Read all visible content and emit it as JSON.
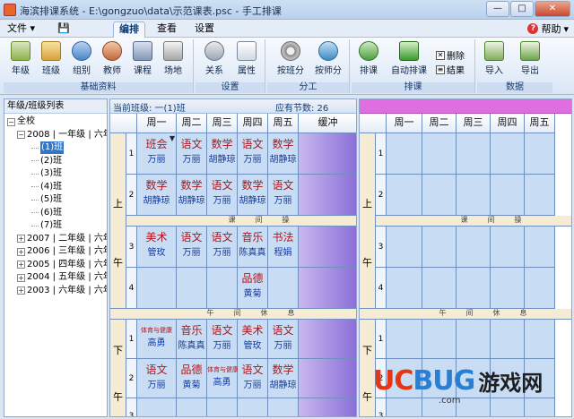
{
  "window": {
    "title": "海滨排课系统 - E:\\gongzuo\\data\\示范课表.psc - 手工排课",
    "minimize": "—",
    "maximize": "□",
    "close": "✕"
  },
  "menubar": {
    "file": "文件",
    "tabs": [
      "编排",
      "查看",
      "设置"
    ],
    "active_tab": "编排",
    "help": "帮助"
  },
  "ribbon": {
    "groups": [
      {
        "label": "基础资料",
        "buttons": [
          "年级",
          "班级",
          "组别",
          "教师",
          "课程",
          "场地"
        ]
      },
      {
        "label": "设置",
        "buttons": [
          "关系",
          "属性"
        ]
      },
      {
        "label": "分工",
        "buttons": [
          "按班分",
          "按师分"
        ]
      },
      {
        "label": "排课",
        "buttons": [
          "排课",
          "自动排课"
        ],
        "small": [
          "删除",
          "结果"
        ]
      },
      {
        "label": "数据",
        "buttons": [
          "导入",
          "导出"
        ]
      }
    ]
  },
  "left_panel": {
    "header": "年级/班级列表",
    "tree": [
      {
        "label": "全校",
        "level": 0,
        "toggle": "−"
      },
      {
        "label": "2008 | 一年级 | 六年",
        "level": 1,
        "toggle": "−"
      },
      {
        "label": "(1)班",
        "level": 2,
        "selected": true
      },
      {
        "label": "(2)班",
        "level": 2
      },
      {
        "label": "(3)班",
        "level": 2
      },
      {
        "label": "(4)班",
        "level": 2
      },
      {
        "label": "(5)班",
        "level": 2
      },
      {
        "label": "(6)班",
        "level": 2
      },
      {
        "label": "(7)班",
        "level": 2
      },
      {
        "label": "2007 | 二年级 | 六年",
        "level": 1,
        "toggle": "+"
      },
      {
        "label": "2006 | 三年级 | 六年",
        "level": 1,
        "toggle": "+"
      },
      {
        "label": "2005 | 四年级 | 六年",
        "level": 1,
        "toggle": "+"
      },
      {
        "label": "2004 | 五年级 | 六年",
        "level": 1,
        "toggle": "+"
      },
      {
        "label": "2003 | 六年级 | 六年",
        "level": 1,
        "toggle": "+"
      }
    ]
  },
  "schedule": {
    "current_class_label": "当前班级: 一(1)班",
    "required_periods_label": "应有节数: 26",
    "days": [
      "周一",
      "周二",
      "周三",
      "周四",
      "周五"
    ],
    "buffer_label": "缓冲",
    "sessions": {
      "morning": [
        "上",
        "午"
      ],
      "afternoon": [
        "下",
        "午"
      ]
    },
    "break_label": "课间操",
    "noon_label": "午间休息",
    "periods_morning": [
      "1",
      "2",
      "3",
      "4"
    ],
    "periods_afternoon": [
      "1",
      "2",
      "3"
    ],
    "slots": {
      "m1": [
        {
          "course": "班会",
          "teacher": "万丽"
        },
        {
          "course": "语文",
          "teacher": "万丽"
        },
        {
          "course": "数学",
          "teacher": "胡静琼"
        },
        {
          "course": "语文",
          "teacher": "万丽"
        },
        {
          "course": "数学",
          "teacher": "胡静琼"
        }
      ],
      "m2": [
        {
          "course": "数学",
          "teacher": "胡静琼"
        },
        {
          "course": "数学",
          "teacher": "胡静琼"
        },
        {
          "course": "语文",
          "teacher": "万丽"
        },
        {
          "course": "数学",
          "teacher": "胡静琼"
        },
        {
          "course": "语文",
          "teacher": "万丽"
        }
      ],
      "m3": [
        {
          "course": "美术",
          "teacher": "管玫"
        },
        {
          "course": "语文",
          "teacher": "万丽"
        },
        {
          "course": "语文",
          "teacher": "万丽"
        },
        {
          "course": "音乐",
          "teacher": "陈真真"
        },
        {
          "course": "书法",
          "teacher": "程娟"
        }
      ],
      "m4": [
        {
          "course": "",
          "teacher": ""
        },
        {
          "course": "",
          "teacher": ""
        },
        {
          "course": "",
          "teacher": ""
        },
        {
          "course": "品德",
          "teacher": "黄菊"
        },
        {
          "course": "",
          "teacher": ""
        }
      ],
      "a1": [
        {
          "course": "体育与健康",
          "teacher": "高勇",
          "small": true
        },
        {
          "course": "音乐",
          "teacher": "陈真真"
        },
        {
          "course": "语文",
          "teacher": "万丽"
        },
        {
          "course": "美术",
          "teacher": "管玫"
        },
        {
          "course": "语文",
          "teacher": "万丽"
        }
      ],
      "a2": [
        {
          "course": "语文",
          "teacher": "万丽"
        },
        {
          "course": "品德",
          "teacher": "黄菊"
        },
        {
          "course": "体育与健康",
          "teacher": "高勇",
          "small": true
        },
        {
          "course": "语文",
          "teacher": "万丽"
        },
        {
          "course": "数学",
          "teacher": "胡静琼"
        }
      ]
    }
  },
  "watermark": {
    "logo_u": "U",
    "logo_c": "C",
    "logo_bug": "BUG",
    "cn": "游戏网",
    "sub": ".com"
  }
}
